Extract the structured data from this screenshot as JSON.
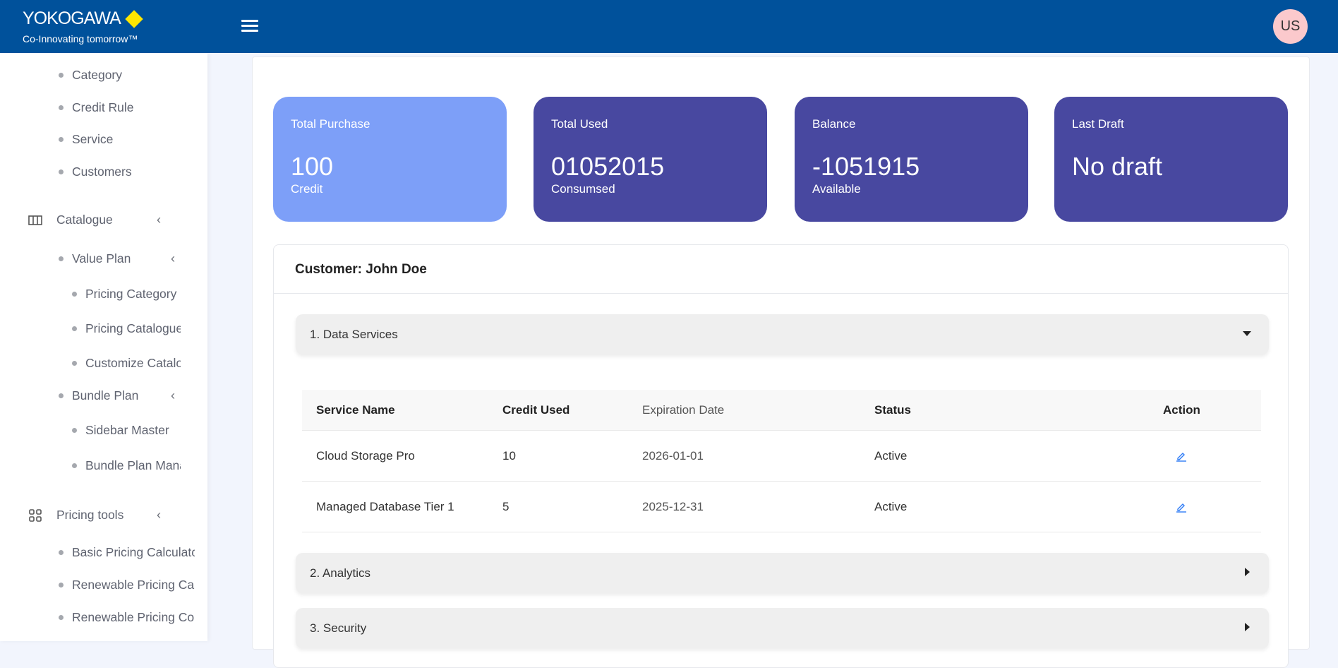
{
  "header": {
    "brand": "YOKOGAWA",
    "tagline": "Co-Innovating tomorrow™",
    "user_initials": "US"
  },
  "sidebar": {
    "items": [
      {
        "label": "Category",
        "level": 1
      },
      {
        "label": "Credit Rule",
        "level": 1
      },
      {
        "label": "Service",
        "level": 1
      },
      {
        "label": "Customers",
        "level": 1
      },
      {
        "label": "Catalogue",
        "level": 0,
        "icon": "columns-icon"
      },
      {
        "label": "Value Plan",
        "level": 1
      },
      {
        "label": "Pricing Category",
        "level": 2
      },
      {
        "label": "Pricing Catalogue",
        "level": 2
      },
      {
        "label": "Customize Catalogue",
        "level": 2
      },
      {
        "label": "Bundle Plan",
        "level": 1
      },
      {
        "label": "Sidebar Master",
        "level": 2
      },
      {
        "label": "Bundle Plan Management",
        "level": 2
      },
      {
        "label": "Pricing tools",
        "level": 0,
        "icon": "grid-icon"
      },
      {
        "label": "Basic Pricing Calculator",
        "level": 1
      },
      {
        "label": "Renewable Pricing Calculator",
        "level": 1
      },
      {
        "label": "Renewable Pricing Comparison",
        "level": 1
      }
    ]
  },
  "cards": [
    {
      "title": "Total Purchase",
      "value": "100",
      "sub": "Credit",
      "color": "#7d9ff8"
    },
    {
      "title": "Total Used",
      "value": "01052015",
      "sub": "Consumsed",
      "color": "#4848a0"
    },
    {
      "title": "Balance",
      "value": "-1051915",
      "sub": "Available",
      "color": "#4848a0"
    },
    {
      "title": "Last Draft",
      "value": "No draft",
      "sub": "",
      "color": "#4848a0"
    }
  ],
  "customer": {
    "title": "Customer: John Doe"
  },
  "sections": [
    {
      "label": "1. Data Services",
      "expanded": true
    },
    {
      "label": "2. Analytics",
      "expanded": false
    },
    {
      "label": "3. Security",
      "expanded": false
    }
  ],
  "table": {
    "headers": [
      "Service Name",
      "Credit Used",
      "Expiration Date",
      "Status",
      "Action"
    ],
    "rows": [
      {
        "name": "Cloud Storage Pro",
        "credit": "10",
        "exp": "2026-01-01",
        "status": "Active"
      },
      {
        "name": "Managed Database Tier 1",
        "credit": "5",
        "exp": "2025-12-31",
        "status": "Active"
      }
    ]
  }
}
